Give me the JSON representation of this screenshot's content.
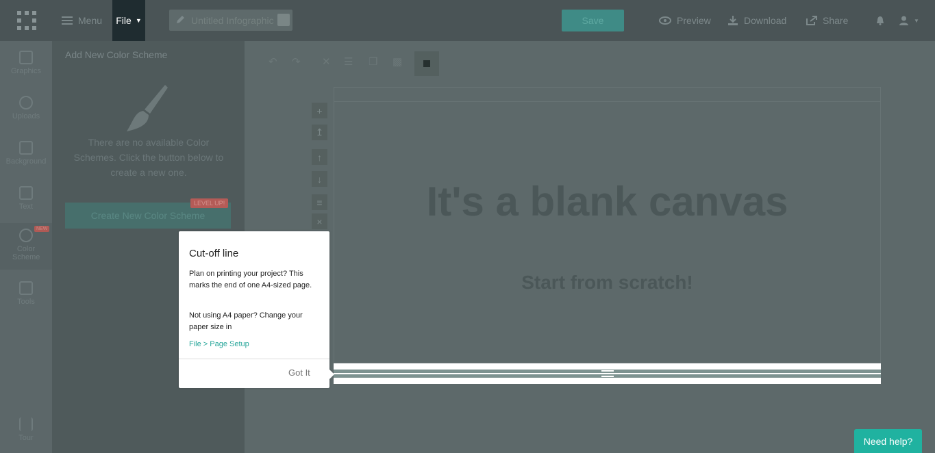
{
  "header": {
    "menu_label": "Menu",
    "file_label": "File",
    "title_placeholder": "Untitled Infographic",
    "save_label": "Save",
    "preview_label": "Preview",
    "download_label": "Download",
    "share_label": "Share"
  },
  "sidebar": {
    "items": [
      {
        "label": "Graphics",
        "icon": "image-icon"
      },
      {
        "label": "Uploads",
        "icon": "cloud-upload-icon"
      },
      {
        "label": "Background",
        "icon": "background-icon"
      },
      {
        "label": "Text",
        "icon": "text-icon"
      },
      {
        "label": "Color Scheme",
        "icon": "palette-icon"
      },
      {
        "label": "Tools",
        "icon": "briefcase-icon"
      },
      {
        "label": "Tour",
        "icon": "signpost-icon"
      }
    ],
    "new_badge": "NEW"
  },
  "panel": {
    "title": "Add New Color Scheme",
    "empty_message": "There are no available Color Schemes. Click the button below to create a new one.",
    "create_button": "Create New Color Scheme",
    "level_badge": "LEVEL UP!"
  },
  "canvas": {
    "headline": "It's a blank canvas",
    "subheadline": "Start from scratch!"
  },
  "popover": {
    "title": "Cut-off line",
    "text1": "Plan on printing your project? This marks the end of one A4-sized page.",
    "text2": "Not using A4 paper? Change your paper size in",
    "link": "File > Page Setup",
    "button": "Got It"
  },
  "help": {
    "label": "Need help?"
  },
  "colors": {
    "accent": "#20b2a0",
    "topbar": "#4a5456",
    "file_tab": "#1f2c30"
  }
}
